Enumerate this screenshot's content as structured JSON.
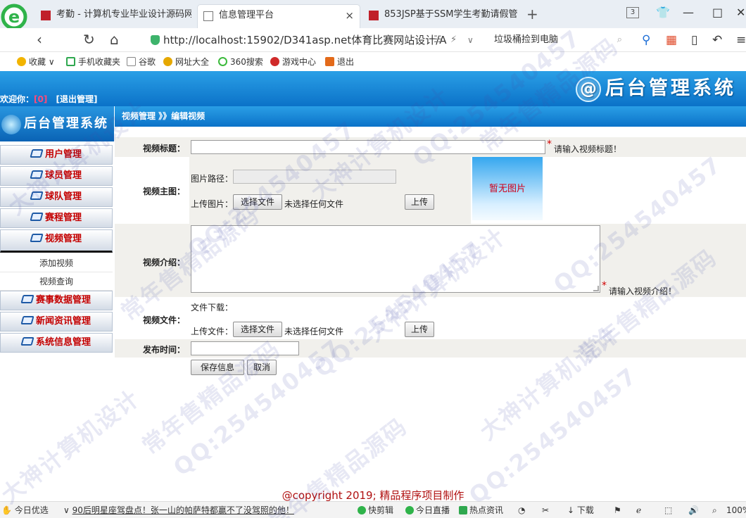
{
  "browser": {
    "tabs": [
      {
        "title": "考勤 - 计算机专业毕业设计源码网",
        "active": false
      },
      {
        "title": "信息管理平台",
        "active": true,
        "close": "×"
      },
      {
        "title": "853JSP基于SSM学生考勤请假管",
        "active": false
      }
    ],
    "new_tab": "+",
    "tab_count": "3",
    "url": "http://localhost:15902/D341asp.net体育比赛网站设计/A",
    "search_text": "垃圾桶捡到电脑",
    "bookmarks": [
      "收藏",
      "手机收藏夹",
      "谷歌",
      "网址大全",
      "360搜索",
      "游戏中心",
      "退出"
    ]
  },
  "header": {
    "brand": "后台管理系统",
    "welcome_prefix": "欢迎你：",
    "username": "[0]",
    "logout": "[退出管理]"
  },
  "sidebar": {
    "title": "后台管理系统",
    "items": [
      {
        "label": "用户管理"
      },
      {
        "label": "球员管理"
      },
      {
        "label": "球队管理"
      },
      {
        "label": "赛程管理"
      },
      {
        "label": "视频管理",
        "open": true
      },
      {
        "label": "赛事数据管理"
      },
      {
        "label": "新闻资讯管理"
      },
      {
        "label": "系统信息管理"
      }
    ],
    "subitems": [
      "添加视频",
      "视频查询"
    ]
  },
  "breadcrumb": "视频管理 》》编辑视频",
  "form": {
    "title_label": "视频标题：",
    "title_value": "",
    "title_hint": "请输入视频标题！",
    "required_mark": "*",
    "image_label": "视频主图：",
    "image_path_label": "图片路径：",
    "image_path_value": "",
    "upload_image_label": "上传图片：",
    "choose_file": "选择文件",
    "no_file": "未选择任何文件",
    "upload_button": "上传",
    "no_image": "暂无图片",
    "intro_label": "视频介绍：",
    "intro_value": "",
    "intro_hint": "请输入视频介绍！",
    "file_label": "视频文件：",
    "file_download_label": "文件下载：",
    "upload_file_label": "上传文件：",
    "time_label": "发布时间：",
    "time_value": "",
    "save_button": "保存信息",
    "cancel_button": "取消"
  },
  "copyright": "@copyright 2019; 精品程序项目制作",
  "statusbar": {
    "left_items": [
      "今日优选",
      "90后明星座驾盘点！张一山的帕萨特都赢不了没驾照的他！"
    ],
    "right_items": [
      "快剪辑",
      "今日直播",
      "热点资讯",
      "下载"
    ],
    "zoom": "100%"
  },
  "watermark": [
    "QQ:254540457",
    "大神计算机设计",
    "常年售精品源码"
  ],
  "colors": {
    "header_blue": "#0b72c8",
    "menu_red": "#c40000",
    "required_red": "#d00000",
    "copyright_red": "#b01010"
  }
}
